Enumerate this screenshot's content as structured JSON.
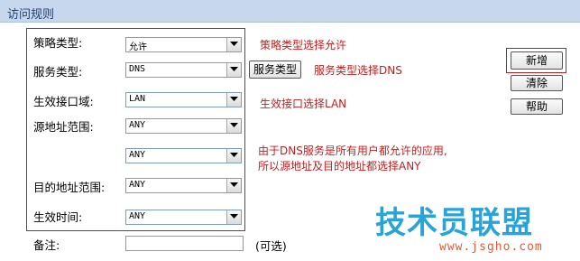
{
  "section_title": "访问规则",
  "form": {
    "policy_type": {
      "label": "策略类型:",
      "value": "允许"
    },
    "service_type": {
      "label": "服务类型:",
      "value": "DNS",
      "button": "服务类型"
    },
    "interface": {
      "label": "生效接口域:",
      "value": "LAN"
    },
    "source": {
      "label": "源地址范围:",
      "value_1": "ANY",
      "value_2": "ANY"
    },
    "destination": {
      "label": "目的地址范围:",
      "value": "ANY"
    },
    "time": {
      "label": "生效时间:",
      "value": "ANY"
    },
    "remark": {
      "label": "备注:",
      "value": "",
      "hint": "(可选)"
    }
  },
  "annotations": {
    "policy": "策略类型选择允许",
    "service": "服务类型选择DNS",
    "interface": "生效接口选择LAN",
    "reason_line1": "由于DNS服务是所有用户都允许的应用,",
    "reason_line2": "所以源地址及目的地址都选择ANY"
  },
  "actions": {
    "new": "新增",
    "clear": "清除",
    "help": "帮助"
  },
  "watermark": {
    "logo": "技术员联盟",
    "url": "www.jsgho.com"
  },
  "colors": {
    "annotation": "#c01e1e",
    "titlebar": "#c7d8ee"
  }
}
